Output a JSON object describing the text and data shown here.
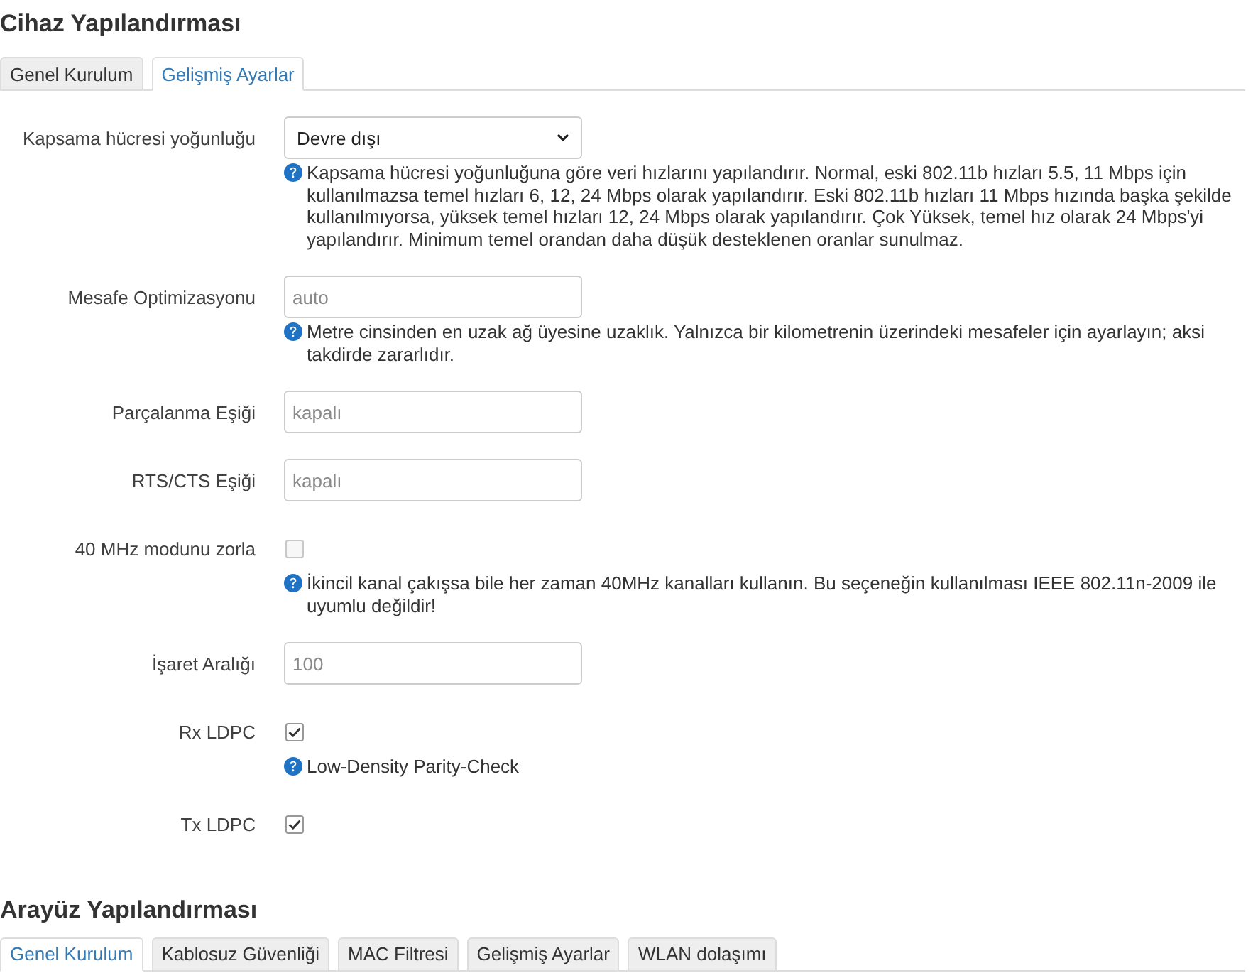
{
  "sections": [
    {
      "title": "Cihaz Yapılandırması",
      "tabs": [
        {
          "label": "Genel Kurulum",
          "selected": false
        },
        {
          "label": "Gelişmiş Ayarlar",
          "selected": true
        }
      ],
      "fields": [
        {
          "kind": "select",
          "label": "Kapsama hücresi yoğunluğu",
          "value": "Devre dışı",
          "help": "Kapsama hücresi yoğunluğuna göre veri hızlarını yapılandırır. Normal, eski 802.11b hızları 5.5, 11 Mbps için kullanılmazsa temel hızları 6, 12, 24 Mbps olarak yapılandırır. Eski 802.11b hızları 11 Mbps hızında başka şekilde kullanılmıyorsa, yüksek temel hızları 12, 24 Mbps olarak yapılandırır. Çok Yüksek, temel hız olarak 24 Mbps'yi yapılandırır. Minimum temel orandan daha düşük desteklenen oranlar sunulmaz."
        },
        {
          "kind": "text",
          "label": "Mesafe Optimizasyonu",
          "placeholder": "auto",
          "help": "Metre cinsinden en uzak ağ üyesine uzaklık. Yalnızca bir kilometrenin üzerindeki mesafeler için ayarlayın; aksi takdirde zararlıdır."
        },
        {
          "kind": "text",
          "label": "Parçalanma Eşiği",
          "placeholder": "kapalı"
        },
        {
          "kind": "text",
          "label": "RTS/CTS Eşiği",
          "placeholder": "kapalı"
        },
        {
          "kind": "checkbox",
          "label": "40 MHz modunu zorla",
          "checked": false,
          "help": "İkincil kanal çakışsa bile her zaman 40MHz kanalları kullanın. Bu seçeneğin kullanılması IEEE 802.11n-2009 ile uyumlu değildir!"
        },
        {
          "kind": "text",
          "label": "İşaret Aralığı",
          "placeholder": "100"
        },
        {
          "kind": "checkbox",
          "label": "Rx LDPC",
          "checked": true,
          "help": "Low-Density Parity-Check"
        },
        {
          "kind": "checkbox",
          "label": "Tx LDPC",
          "checked": true
        }
      ]
    },
    {
      "title": "Arayüz Yapılandırması",
      "tabs": [
        {
          "label": "Genel Kurulum",
          "selected": true
        },
        {
          "label": "Kablosuz Güvenliği",
          "selected": false
        },
        {
          "label": "MAC Filtresi",
          "selected": false
        },
        {
          "label": "Gelişmiş Ayarlar",
          "selected": false
        },
        {
          "label": "WLAN dolaşımı",
          "selected": false
        }
      ]
    }
  ]
}
